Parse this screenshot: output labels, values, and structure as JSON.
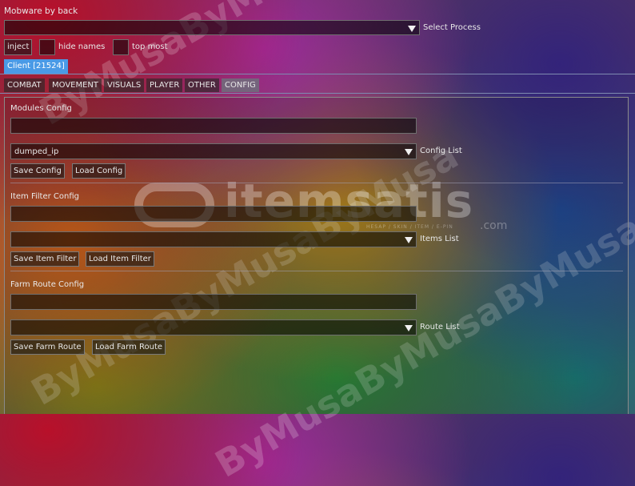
{
  "window": {
    "title": "Mobware by back"
  },
  "process": {
    "value": "",
    "label": "Select Process"
  },
  "toolbar": {
    "inject": "inject",
    "hide_names": "hide names",
    "top_most": "top most"
  },
  "client_tab": "Client [21524]",
  "tabs": [
    "COMBAT",
    "MOVEMENT",
    "VISUALS",
    "PLAYER",
    "OTHER",
    "CONFIG"
  ],
  "modules": {
    "header": "Modules Config",
    "input_value": "",
    "list_value": "dumped_ip",
    "list_label": "Config List",
    "save": "Save Config",
    "load": "Load Config"
  },
  "items": {
    "header": "Item Filter Config",
    "input_value": "",
    "list_value": "",
    "list_label": "Items List",
    "save": "Save Item Filter",
    "load": "Load Item Filter"
  },
  "route": {
    "header": "Farm Route Config",
    "input_value": "",
    "list_value": "",
    "list_label": "Route List",
    "save": "Save Farm Route",
    "load": "Load Farm Route"
  },
  "watermark": {
    "logo_text": "itemsatis",
    "logo_suffix": ".com",
    "logo_tagline": "HESAP / SKIN / ITEM / E-PIN",
    "overlay": "ByMusaByMusaByMusa"
  },
  "colors": {
    "accent": "#4a9ae6",
    "separator": "#7e8ab0"
  }
}
